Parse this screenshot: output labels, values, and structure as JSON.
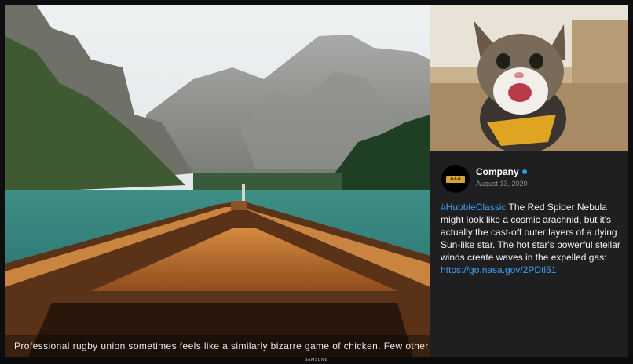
{
  "ticker": {
    "text": "Professional rugby union sometimes feels like a similarly bizarre game of chicken. Few other team spor"
  },
  "post": {
    "author": "Company",
    "date": "August 13, 2020",
    "avatar_text": "AAA",
    "hashtag": "#HubbleClassic",
    "body": " The Red Spider Nebula might look like a cosmic arachnid, but it's actually the cast-off outer layers of a dying Sun-like star. The hot star's powerful stellar winds create waves in the expelled gas: ",
    "link": "https://go.nasa.gov/2PDtl51"
  },
  "bezel": {
    "brand": "SAMSUNG"
  },
  "colors": {
    "link": "#3c9df0",
    "verified": "#2d9bf0",
    "panel": "#1f1f21"
  }
}
